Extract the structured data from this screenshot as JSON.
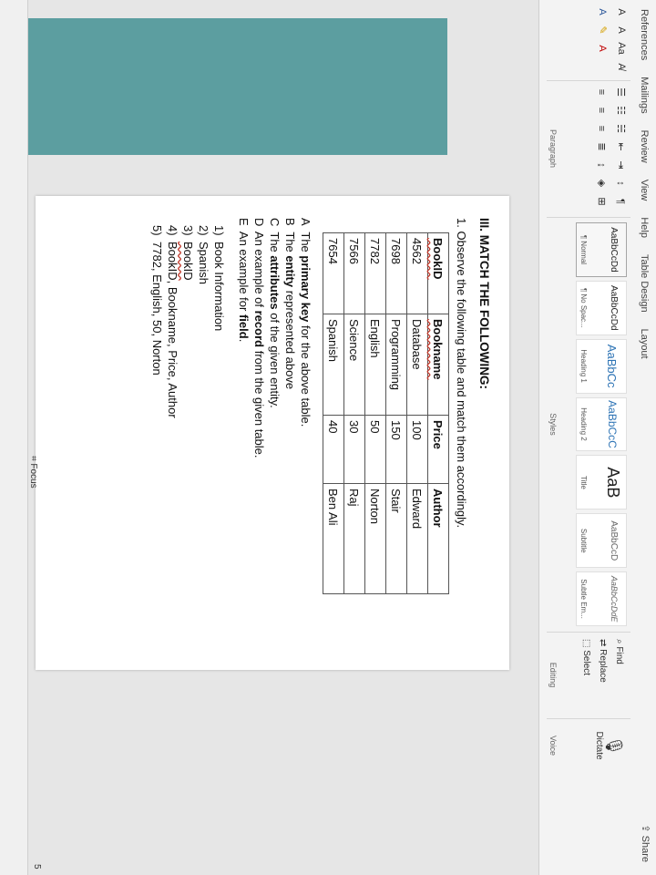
{
  "ribbon": {
    "tabs": [
      "References",
      "Mailings",
      "Review",
      "View",
      "Help",
      "Table Design",
      "Layout"
    ],
    "share_label": "Share",
    "groups": {
      "paragraph_label": "Paragraph",
      "styles_label": "Styles",
      "editing_label": "Editing",
      "voice_label": "Voice"
    },
    "styles": [
      {
        "sample": "AaBbCcDd",
        "name": "¶ Normal"
      },
      {
        "sample": "AaBbCcDd",
        "name": "¶ No Spac..."
      },
      {
        "sample": "AaBbCc",
        "name": "Heading 1"
      },
      {
        "sample": "AaBbCcC",
        "name": "Heading 2"
      },
      {
        "sample": "AaB",
        "name": "Title"
      },
      {
        "sample": "AaBbCcD",
        "name": "Subtitle"
      },
      {
        "sample": "AaBbCcDdE",
        "name": "Subtle Em..."
      }
    ],
    "editing": {
      "find": "Find",
      "replace": "Replace",
      "select": "Select"
    },
    "dictate": "Dictate"
  },
  "document": {
    "heading": "III. MATCH THE FOLLOWING:",
    "instruction": "1. Observe the following table and match them accordingly.",
    "table": {
      "headers": [
        "BookID",
        "Bookname",
        "Price",
        "Author"
      ],
      "rows": [
        [
          "4562",
          "Database",
          "100",
          "Edward"
        ],
        [
          "7698",
          "Programming",
          "150",
          "Stair"
        ],
        [
          "7782",
          "English",
          "50",
          "Norton"
        ],
        [
          "7566",
          "Science",
          "30",
          "Raj"
        ],
        [
          "7654",
          "Spanish",
          "40",
          "Ben Ali"
        ]
      ]
    },
    "definitions": [
      {
        "letter": "A",
        "pre": "The ",
        "bold": "primary key",
        "post": " for the above table."
      },
      {
        "letter": "B",
        "pre": "The ",
        "bold": "entity",
        "post": " represented above"
      },
      {
        "letter": "C",
        "pre": "The ",
        "bold": "attributes",
        "post": " of the given entity."
      },
      {
        "letter": "D",
        "pre": "An example of ",
        "bold": "record",
        "post": " from the given table."
      },
      {
        "letter": "E",
        "pre": "An example for ",
        "bold": "field",
        "post": "."
      }
    ],
    "answers": [
      {
        "n": "1)",
        "text": "Book Information"
      },
      {
        "n": "2)",
        "text": "Spanish"
      },
      {
        "n": "3)",
        "text": "BookID"
      },
      {
        "n": "4)",
        "text": "BookID, Bookname, Price, Author"
      },
      {
        "n": "5)",
        "text": "7782, English, 50, Norton"
      }
    ]
  },
  "status": {
    "focus": "Focus",
    "page_marker": "5"
  },
  "colors": {
    "teal_panel": "#5c9ea0",
    "accent": "#2b579a"
  }
}
